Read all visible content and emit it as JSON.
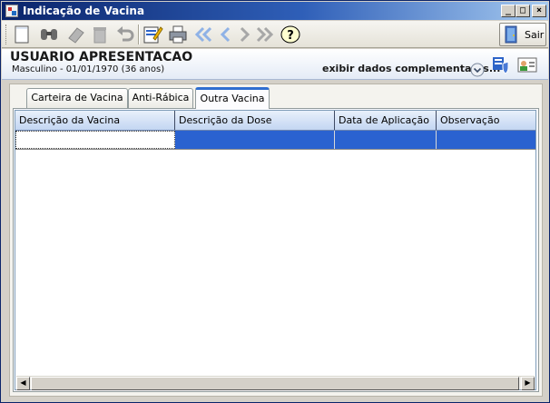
{
  "window": {
    "title": "Indicação de Vacina"
  },
  "toolbar": {
    "buttons": [
      "new-icon",
      "find-icon",
      "eraser-icon",
      "delete-icon",
      "undo-icon",
      "edit-icon",
      "print-icon",
      "first-icon",
      "previous-icon",
      "next-icon",
      "last-icon",
      "help-icon"
    ],
    "exit_label": "Sair"
  },
  "patient": {
    "name": "USUARIO APRESENTACAO",
    "info": "Masculino - 01/01/1970 (36 anos)",
    "complement_link": "exibir dados complementares..."
  },
  "tabs": [
    {
      "label": "Carteira de Vacina",
      "active": false
    },
    {
      "label": "Anti-Rábica",
      "active": false
    },
    {
      "label": "Outra Vacina",
      "active": true
    }
  ],
  "grid": {
    "columns": [
      "Descrição da Vacina",
      "Descrição da Dose",
      "Data de Aplicação",
      "Observação"
    ],
    "rows": [
      [
        "",
        "",
        "",
        ""
      ]
    ],
    "selection_color": "#2a62d0"
  },
  "colors": {
    "titlebar": "#0a246a",
    "header_bg": "#e4ebf6",
    "accent_tab": "#2f6ed0"
  }
}
